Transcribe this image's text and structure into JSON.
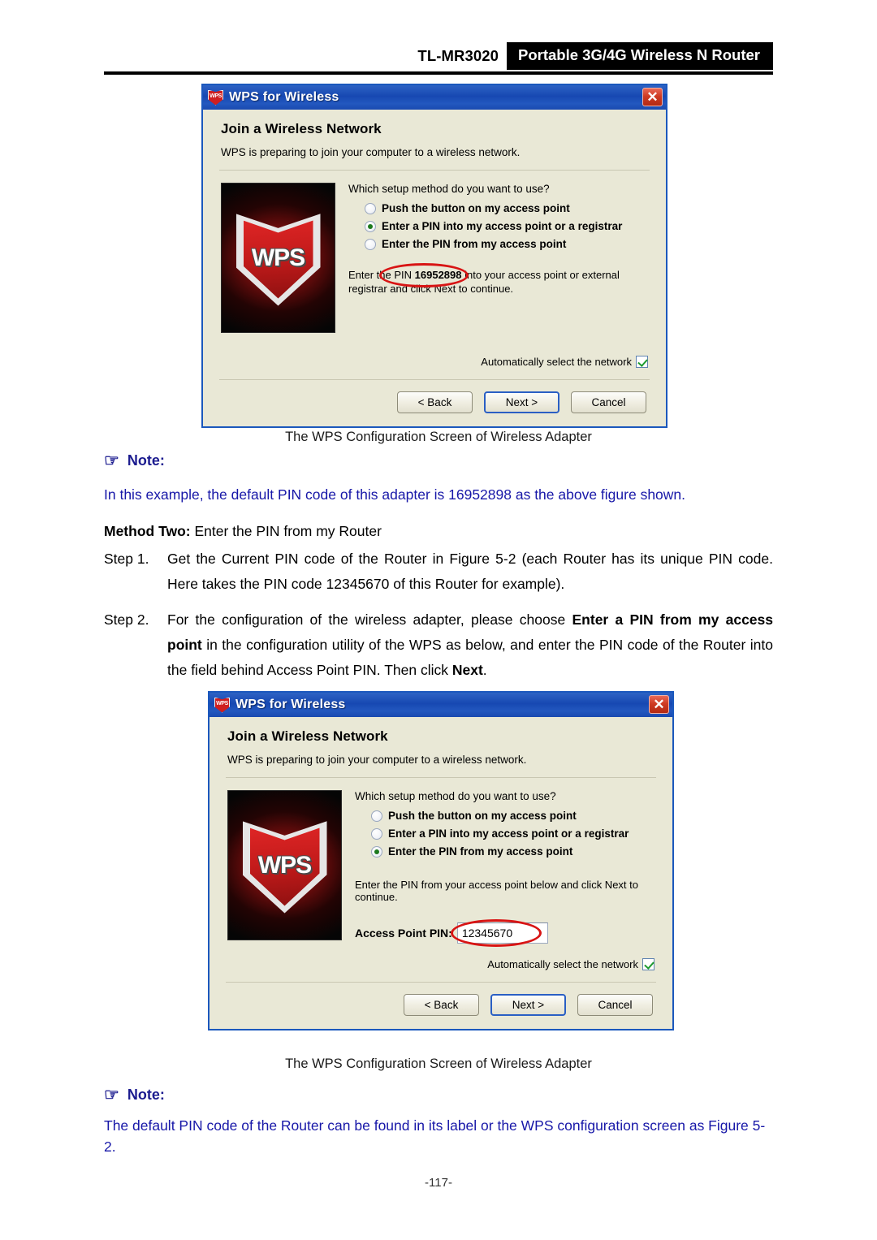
{
  "header": {
    "model": "TL-MR3020",
    "product": "Portable 3G/4G Wireless N Router"
  },
  "dialog_one": {
    "titlebar": {
      "icon": "wps-shield-icon",
      "title": "WPS for Wireless",
      "close_label": "✕"
    },
    "heading": "Join a Wireless Network",
    "subtitle": "WPS is preparing to join your computer to a wireless network.",
    "graphic_label": "WPS",
    "prompt": "Which setup method do you want to use?",
    "options": [
      {
        "label": "Push the button on my access point",
        "selected": false
      },
      {
        "label": "Enter a PIN into my access point or a registrar",
        "selected": true
      },
      {
        "label": "Enter the PIN from my access point",
        "selected": false
      }
    ],
    "pin_text_before": "Enter the PIN ",
    "pin_value": "16952898",
    "pin_text_after": " into your access point or external registrar and click Next to continue.",
    "auto_select_label": "Automatically select the network",
    "auto_select_checked": true,
    "buttons": {
      "back": "< Back",
      "next": "Next >",
      "cancel": "Cancel"
    },
    "caption": "The WPS Configuration Screen of Wireless Adapter"
  },
  "note_one": {
    "hand_icon": "☞",
    "label": "Note:",
    "text": "In this example, the default PIN code of this adapter is 16952898 as the above figure shown."
  },
  "method_two": {
    "bold_label": "Method Two:",
    "rest": " Enter the PIN from my Router"
  },
  "step_one": {
    "label": "Step 1.",
    "text": "Get the Current PIN code of the Router in Figure 5-2 (each Router has its unique PIN code. Here takes the PIN code 12345670 of this Router for example)."
  },
  "step_two": {
    "label": "Step 2.",
    "part1": "For the configuration of the wireless adapter, please choose ",
    "bold1": "Enter a PIN from my access point",
    "part2": " in the configuration utility of the WPS as below, and enter the PIN code of the Router into the field behind Access Point PIN. Then click ",
    "bold2": "Next",
    "part3": "."
  },
  "dialog_two": {
    "titlebar": {
      "icon": "wps-shield-icon",
      "title": "WPS for Wireless",
      "close_label": "✕"
    },
    "heading": "Join a Wireless Network",
    "subtitle": "WPS is preparing to join your computer to a wireless network.",
    "graphic_label": "WPS",
    "prompt": "Which setup method do you want to use?",
    "options": [
      {
        "label": "Push the button on my access point",
        "selected": false
      },
      {
        "label": "Enter a PIN into my access point or a registrar",
        "selected": false
      },
      {
        "label": "Enter the PIN from my access point",
        "selected": true
      }
    ],
    "instruction": "Enter the PIN from your access point below and click Next to continue.",
    "ap_pin_label": "Access Point PIN:",
    "ap_pin_value": "12345670",
    "auto_select_label": "Automatically select the network",
    "auto_select_checked": true,
    "buttons": {
      "back": "< Back",
      "next": "Next >",
      "cancel": "Cancel"
    },
    "caption": "The WPS Configuration Screen of Wireless Adapter"
  },
  "note_two": {
    "hand_icon": "☞",
    "label": "Note:",
    "text": "The default PIN code of the Router can be found in its label or the WPS configuration screen as Figure 5-2."
  },
  "footer": {
    "page_number": "-117-"
  },
  "colors": {
    "banner_bg": "#000000",
    "note_blue": "#1717a8",
    "titlebar_blue": "#1748b2",
    "dialog_bg": "#e9e8d6",
    "annotation_red": "#d81414"
  }
}
